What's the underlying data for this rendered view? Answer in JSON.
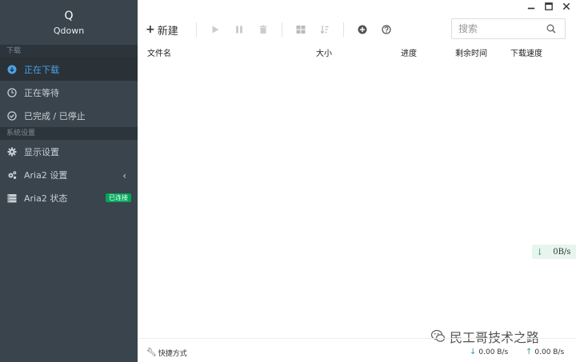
{
  "app": {
    "logo": "Q",
    "name": "Qdown"
  },
  "sidebar": {
    "sections": [
      {
        "header": "下载"
      },
      {
        "header": "系统设置"
      }
    ],
    "items": [
      {
        "label": "正在下载"
      },
      {
        "label": "正在等待"
      },
      {
        "label": "已完成 / 已停止"
      },
      {
        "label": "显示设置"
      },
      {
        "label": "Aria2 设置"
      },
      {
        "label": "Aria2 状态",
        "badge": "已连接"
      }
    ]
  },
  "toolbar": {
    "new_label": "新建"
  },
  "search": {
    "placeholder": "搜索"
  },
  "table": {
    "columns": [
      "文件名",
      "大小",
      "进度",
      "剩余时间",
      "下载速度"
    ]
  },
  "float_speed": "0B/s",
  "watermark": "民工哥技术之路",
  "statusbar": {
    "shortcut": "快捷方式",
    "download_speed": "0.00 B/s",
    "upload_speed": "0.00 B/s"
  },
  "colors": {
    "sidebar_bg": "#3a444c",
    "active_text": "#4aa3e8",
    "badge": "#00a65a"
  }
}
